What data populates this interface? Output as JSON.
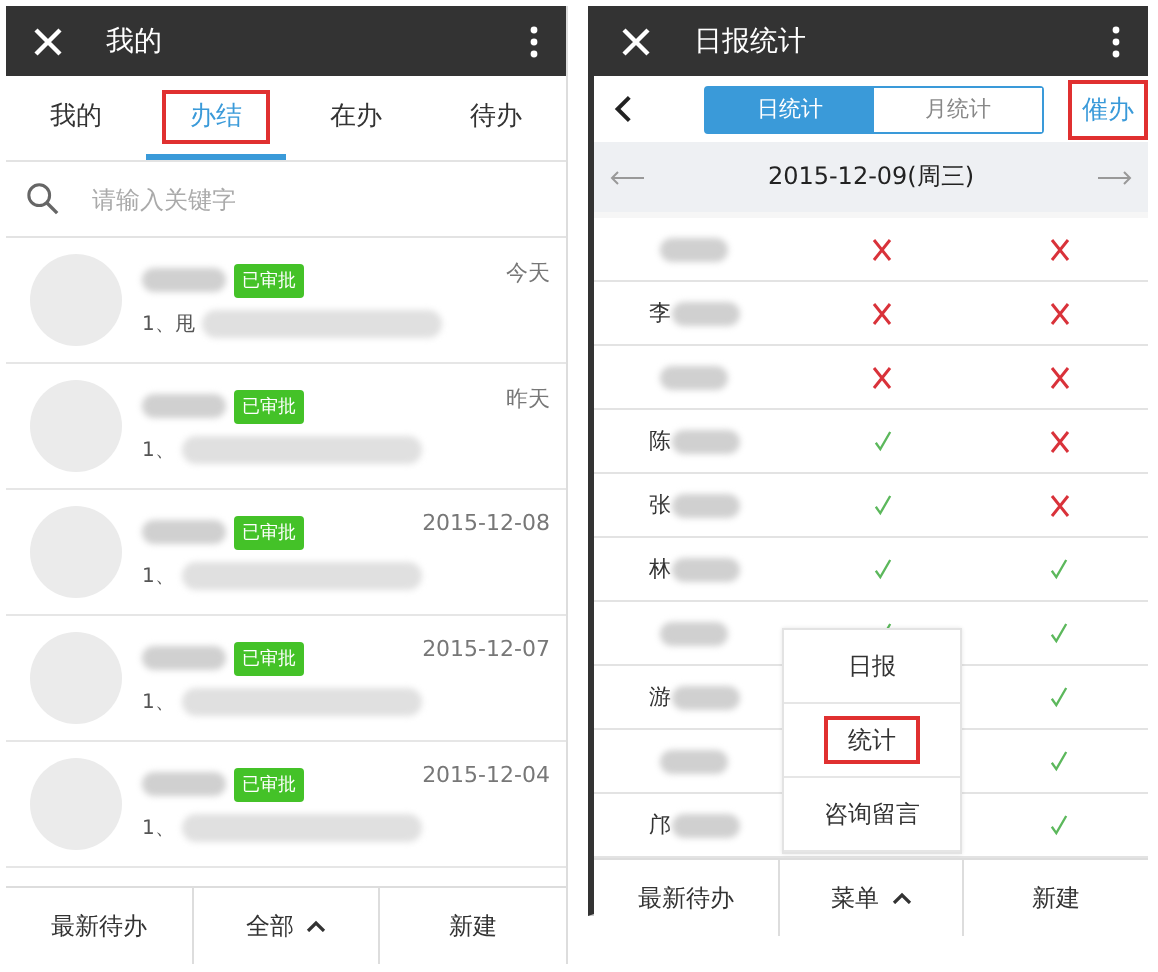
{
  "left_screen": {
    "title_bar": {
      "title": "我的"
    },
    "tabs": [
      {
        "label": "我的",
        "selected": false,
        "highlighted": false
      },
      {
        "label": "办结",
        "selected": true,
        "highlighted": true
      },
      {
        "label": "在办",
        "selected": false,
        "highlighted": false
      },
      {
        "label": "待办",
        "selected": false,
        "highlighted": false
      }
    ],
    "search": {
      "placeholder": "请输入关键字"
    },
    "items": [
      {
        "badge": "已审批",
        "date": "今天",
        "summary": "1、甩"
      },
      {
        "badge": "已审批",
        "date": "昨天",
        "summary": "1、"
      },
      {
        "badge": "已审批",
        "date": "2015-12-08",
        "summary": "1、"
      },
      {
        "badge": "已审批",
        "date": "2015-12-07",
        "summary": "1、"
      },
      {
        "badge": "已审批",
        "date": "2015-12-04",
        "summary": "1、"
      }
    ],
    "bottom_bar": [
      {
        "label": "最新待办",
        "kind": "plain"
      },
      {
        "label": "全部",
        "kind": "dropdown"
      },
      {
        "label": "新建",
        "kind": "plain"
      }
    ]
  },
  "right_screen": {
    "title_bar": {
      "title": "日报统计"
    },
    "segments": [
      {
        "label": "日统计",
        "selected": true
      },
      {
        "label": "月统计",
        "selected": false
      }
    ],
    "urge_button": {
      "label": "催办",
      "highlighted": true
    },
    "date": "2015-12-09(周三)",
    "rows": [
      {
        "name": "",
        "col_2": false,
        "col_3": false
      },
      {
        "name": "李",
        "col_2": false,
        "col_3": false
      },
      {
        "name": "",
        "col_2": false,
        "col_3": false
      },
      {
        "name": "陈",
        "col_2": true,
        "col_3": false
      },
      {
        "name": "张",
        "col_2": true,
        "col_3": false
      },
      {
        "name": "林",
        "col_2": true,
        "col_3": true
      },
      {
        "name": "",
        "col_2": true,
        "col_3": true
      },
      {
        "name": "游",
        "col_3": true
      },
      {
        "name": "",
        "col_3": true
      },
      {
        "name": "邝",
        "col_3": true
      }
    ],
    "popup_menu": [
      {
        "label": "日报",
        "highlighted": false
      },
      {
        "label": "统计",
        "highlighted": true
      },
      {
        "label": "咨询留言",
        "highlighted": false
      }
    ],
    "bottom_bar": [
      {
        "label": "最新待办",
        "kind": "plain"
      },
      {
        "label": "菜单",
        "kind": "dropdown"
      },
      {
        "label": "新建",
        "kind": "plain"
      }
    ]
  }
}
